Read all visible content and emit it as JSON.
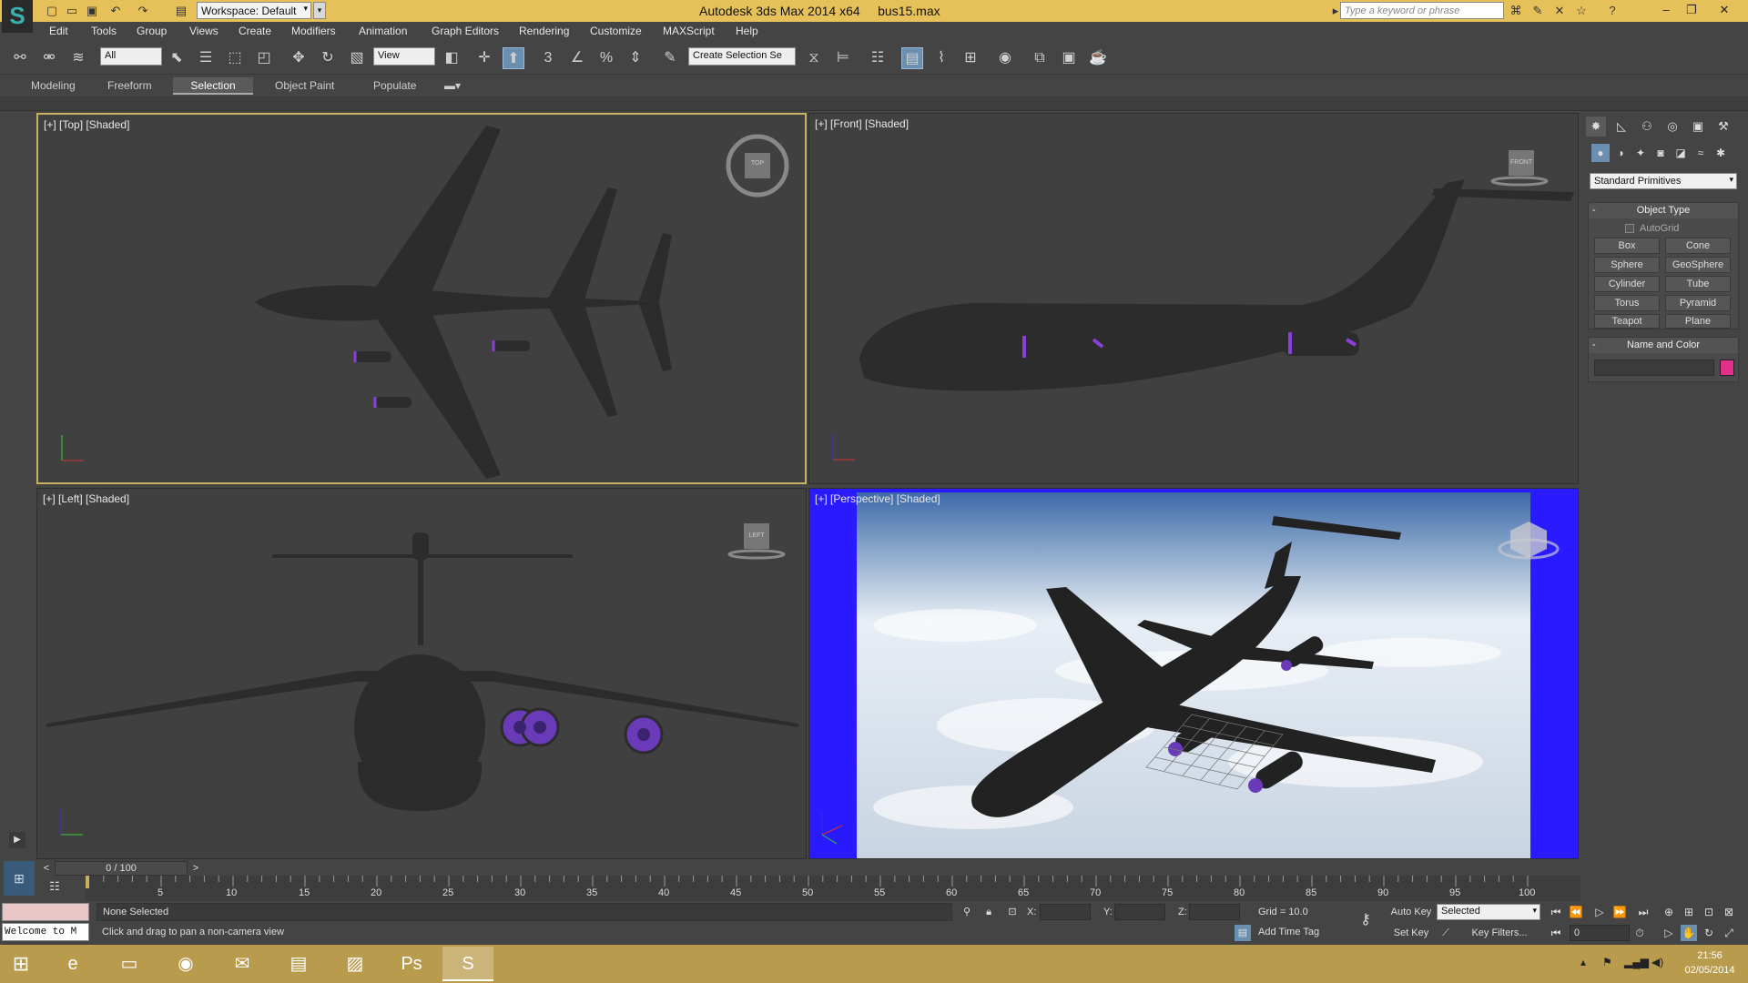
{
  "titlebar": {
    "workspace": "Workspace: Default",
    "app_title": "Autodesk 3ds Max  2014 x64",
    "file_name": "bus15.max",
    "search_placeholder": "Type a keyword or phrase"
  },
  "menu": [
    "Edit",
    "Tools",
    "Group",
    "Views",
    "Create",
    "Modifiers",
    "Animation",
    "Graph Editors",
    "Rendering",
    "Customize",
    "MAXScript",
    "Help"
  ],
  "toolbar": {
    "selection_filter": "All",
    "ref_coord": "View",
    "named_selection_placeholder": "Create Selection Se"
  },
  "ribbon": {
    "tabs": [
      "Modeling",
      "Freeform",
      "Selection",
      "Object Paint",
      "Populate"
    ],
    "active_tab": "Selection"
  },
  "viewports": {
    "top": {
      "label": "[+] [Top] [Shaded]",
      "cube": "TOP"
    },
    "front": {
      "label": "[+] [Front] [Shaded]",
      "cube": "FRONT"
    },
    "left": {
      "label": "[+] [Left] [Shaded]",
      "cube": "LEFT"
    },
    "perspective": {
      "label": "[+] [Perspective] [Shaded]"
    }
  },
  "command_panel": {
    "category": "Standard Primitives",
    "object_type_title": "Object Type",
    "autogrid": "AutoGrid",
    "buttons": [
      "Box",
      "Cone",
      "Sphere",
      "GeoSphere",
      "Cylinder",
      "Tube",
      "Torus",
      "Pyramid",
      "Teapot",
      "Plane"
    ],
    "name_color_title": "Name and Color",
    "object_color": "#e0308a"
  },
  "timeline": {
    "frame": "0 / 100",
    "ticks": [
      "5",
      "10",
      "15",
      "20",
      "25",
      "30",
      "35",
      "40",
      "45",
      "50",
      "55",
      "60",
      "65",
      "70",
      "75",
      "80",
      "85",
      "90",
      "95",
      "100"
    ]
  },
  "status": {
    "selection": "None Selected",
    "prompt": "Click and drag to pan a non-camera view",
    "maxscript": "Welcome to M",
    "x_label": "X:",
    "y_label": "Y:",
    "z_label": "Z:",
    "grid": "Grid = 10.0",
    "add_time_tag": "Add Time Tag",
    "auto_key": "Auto Key",
    "set_key": "Set Key",
    "key_mode": "Selected",
    "key_filters": "Key Filters...",
    "current_frame": "0"
  },
  "taskbar": {
    "time": "21:56",
    "date": "02/05/2014"
  },
  "colors": {
    "titlebar": "#e6c15a",
    "taskbar": "#b89b4c",
    "viewport_bg": "#404040",
    "active_viewport_border": "#c9b163",
    "engine_glow": "#8a3fd8",
    "safe_frame_bar": "#2a1aff"
  }
}
